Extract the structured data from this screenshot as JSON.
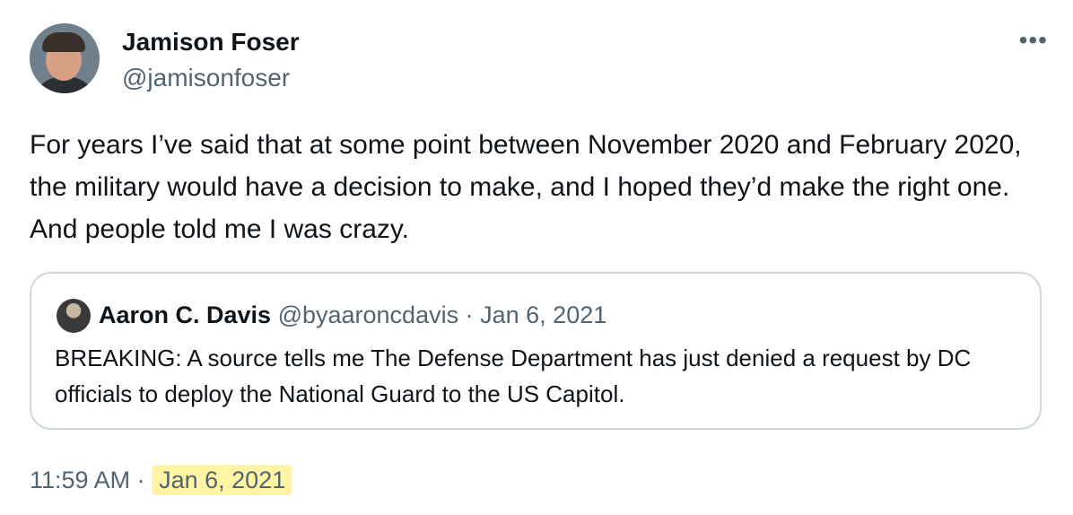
{
  "author": {
    "name": "Jamison Foser",
    "handle": "@jamisonfoser"
  },
  "more_icon": "more-horizontal-icon",
  "tweet": {
    "text": "For years I’ve said that at some point between November 2020 and February 2020, the military would have a decision to make, and I hoped they’d make the right one. And people told me I was crazy."
  },
  "quoted": {
    "name": "Aaron C. Davis",
    "handle": "@byaaroncdavis",
    "separator": "·",
    "date": "Jan 6, 2021",
    "text": "BREAKING: A source tells me The Defense Department has just denied a request by DC officials to deploy the National Guard to the US Capitol."
  },
  "footer": {
    "time": "11:59 AM",
    "separator": "·",
    "date": "Jan 6, 2021",
    "highlight_color": "#fff5a5"
  }
}
